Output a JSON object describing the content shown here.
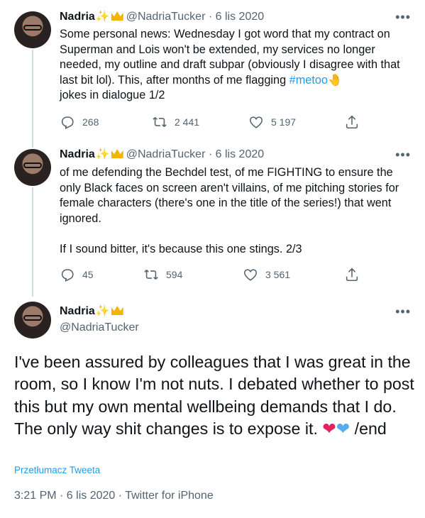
{
  "tweets": [
    {
      "name": "Nadria",
      "handle": "@NadriaTucker",
      "separator": "·",
      "date": "6 lis 2020",
      "more": "•••",
      "text_before": "Some personal news: Wednesday I got word that my contract on Superman and Lois won't be extended, my services no longer needed, my outline and draft subpar (obviously I disagree with that last bit lol). This, after months of me flagging ",
      "hashtag": "#metoo",
      "hashtag_emoji": "🤚",
      "text_after": "\njokes in dialogue 1/2",
      "replies": "268",
      "retweets": "2 441",
      "likes": "5 197"
    },
    {
      "name": "Nadria",
      "handle": "@NadriaTucker",
      "separator": "·",
      "date": "6 lis 2020",
      "more": "•••",
      "text": "of me defending the Bechdel test, of me FIGHTING to ensure the only Black faces on screen aren't villains, of me pitching stories for female characters (there's one in the title of the series!) that went ignored.\n\nIf I sound bitter, it's because this one stings. 2/3",
      "replies": "45",
      "retweets": "594",
      "likes": "3 561"
    }
  ],
  "focal": {
    "name": "Nadria",
    "handle": "@NadriaTucker",
    "more": "•••",
    "text": "I've been assured by colleagues that I was great in the room, so I know I'm not nuts. I debated whether to post this but my own mental wellbeing demands that I do. The only way shit changes is to expose it. ",
    "end_text": " /end",
    "translate_label": "Przetłumacz Tweeta",
    "meta": "3:21 PM · 6 lis 2020 · Twitter for iPhone"
  },
  "emoji": {
    "sparkle": "✨",
    "heart": "❤",
    "blue_heart": "❤"
  },
  "colors": {
    "accent": "#1d9bf0",
    "muted": "#536471",
    "text": "#0f1419",
    "thread_line": "#cfd9de"
  },
  "icons": [
    "reply-icon",
    "retweet-icon",
    "like-icon",
    "share-icon",
    "more-icon",
    "sparkle-icon",
    "crown-icon"
  ]
}
